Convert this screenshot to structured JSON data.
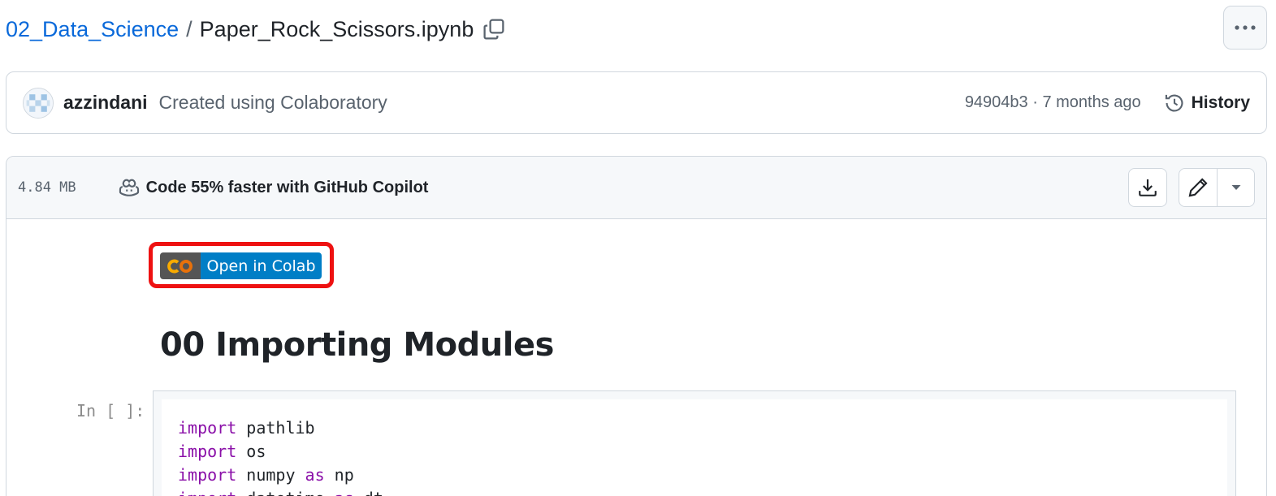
{
  "breadcrumb": {
    "folder": "02_Data_Science",
    "separator": "/",
    "filename": "Paper_Rock_Scissors.ipynb"
  },
  "commit": {
    "author": "azzindani",
    "message": "Created using Colaboratory",
    "meta": "94904b3 · 7 months ago",
    "history_label": "History"
  },
  "file_header": {
    "size": "4.84 MB",
    "copilot_text": "Code 55% faster with GitHub Copilot"
  },
  "notebook": {
    "badge_text": "Open in Colab",
    "heading": "00 Importing Modules",
    "cell_prompt": "In [ ]:",
    "code_lines": [
      {
        "kw": "import",
        "rest1": " pathlib",
        "kw2": "",
        "rest2": ""
      },
      {
        "kw": "import",
        "rest1": " os",
        "kw2": "",
        "rest2": ""
      },
      {
        "kw": "import",
        "rest1": " numpy ",
        "kw2": "as",
        "rest2": " np"
      },
      {
        "kw": "import",
        "rest1": " datetime ",
        "kw2": "as",
        "rest2": " dt"
      }
    ]
  },
  "colors": {
    "link": "#0969da",
    "highlight": "#ee1111",
    "badge_blue": "#007ec6",
    "badge_gray": "#555555",
    "keyword": "#8a0fa8"
  },
  "icons": [
    "copy-path-icon",
    "kebab-menu-icon",
    "avatar",
    "history-icon",
    "copilot-icon",
    "download-icon",
    "pencil-icon",
    "caret-down-icon",
    "colab-logo-icon"
  ]
}
